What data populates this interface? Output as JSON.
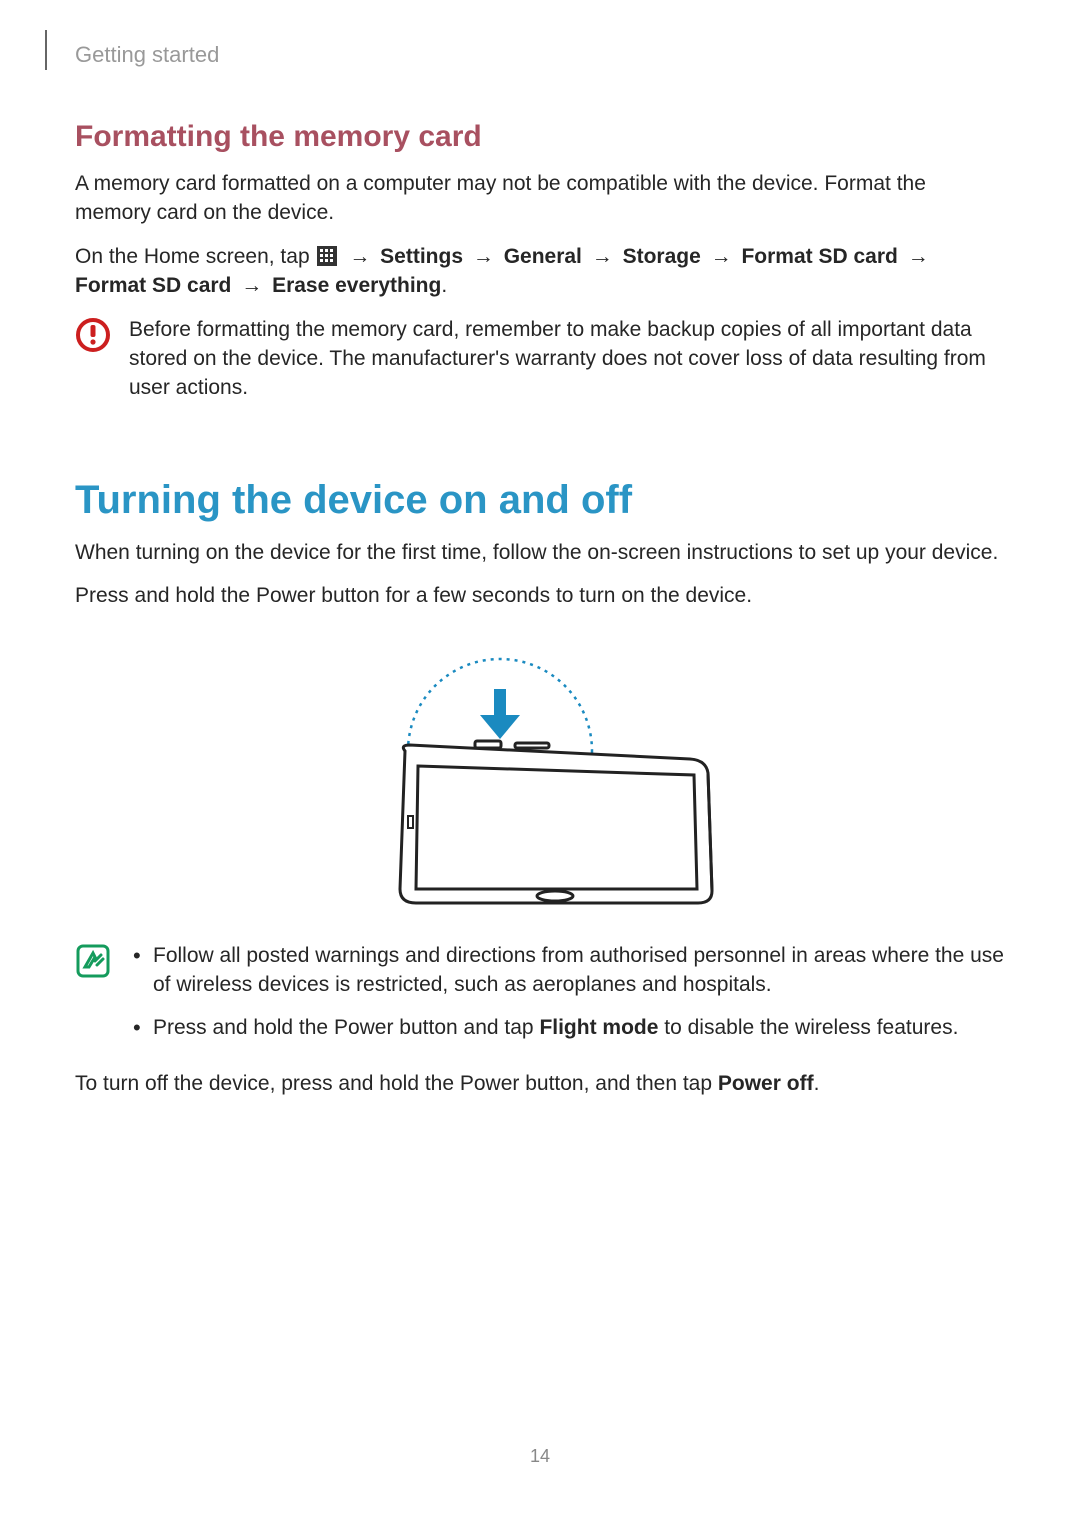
{
  "header": "Getting started",
  "section1": {
    "title": "Formatting the memory card",
    "p1": "A memory card formatted on a computer may not be compatible with the device. Format the memory card on the device.",
    "p2_pre": "On the Home screen, tap ",
    "p2_path": {
      "s1": "Settings",
      "s2": "General",
      "s3": "Storage",
      "s4": "Format SD card",
      "s5": "Format SD card",
      "s6": "Erase everything"
    },
    "caution": "Before formatting the memory card, remember to make backup copies of all important data stored on the device. The manufacturer's warranty does not cover loss of data resulting from user actions."
  },
  "section2": {
    "title": "Turning the device on and off",
    "p1": "When turning on the device for the first time, follow the on-screen instructions to set up your device.",
    "p2": "Press and hold the Power button for a few seconds to turn on the device.",
    "note1": "Follow all posted warnings and directions from authorised personnel in areas where the use of wireless devices is restricted, such as aeroplanes and hospitals.",
    "note2_pre": "Press and hold the Power button and tap ",
    "note2_bold": "Flight mode",
    "note2_post": " to disable the wireless features.",
    "p3_pre": "To turn off the device, press and hold the Power button, and then tap ",
    "p3_bold": "Power off",
    "p3_post": "."
  },
  "pageNumber": "14",
  "arrow": "→"
}
